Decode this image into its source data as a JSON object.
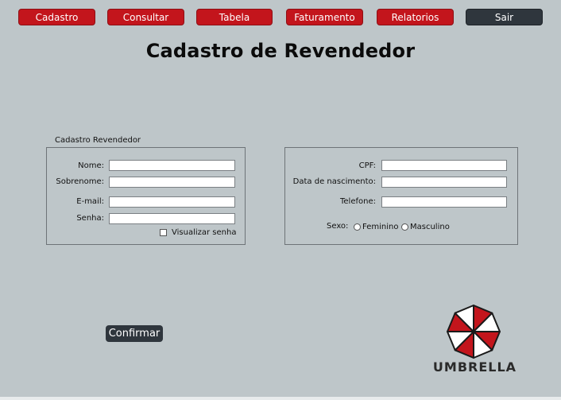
{
  "nav": {
    "items": [
      {
        "label": "Cadastro",
        "color": "#c3151c"
      },
      {
        "label": "Consultar",
        "color": "#c3151c"
      },
      {
        "label": "Tabela",
        "color": "#c3151c"
      },
      {
        "label": "Faturamento",
        "color": "#c3151c"
      },
      {
        "label": "Relatorios",
        "color": "#c3151c"
      },
      {
        "label": "Sair",
        "color": "#2f363d"
      }
    ]
  },
  "page": {
    "title": "Cadastro de Revendedor"
  },
  "form_left": {
    "group_label": "Cadastro Revendedor",
    "fields": {
      "nome": {
        "label": "Nome:",
        "value": ""
      },
      "sobrenome": {
        "label": "Sobrenome:",
        "value": ""
      },
      "email": {
        "label": "E-mail:",
        "value": ""
      },
      "senha": {
        "label": "Senha:",
        "value": ""
      }
    },
    "show_password_label": "Visualizar senha"
  },
  "form_right": {
    "fields": {
      "cpf": {
        "label": "CPF:",
        "value": ""
      },
      "nascimento": {
        "label": "Data de nascimento:",
        "value": ""
      },
      "telefone": {
        "label": "Telefone:",
        "value": ""
      }
    },
    "sexo": {
      "label": "Sexo:",
      "options": [
        "Feminino",
        "Masculino"
      ]
    }
  },
  "actions": {
    "confirm_label": "Confirmar"
  },
  "brand": {
    "name": "UMBRELLA",
    "logo_icon": "umbrella-corporation-logo",
    "accent": "#c3151c"
  }
}
